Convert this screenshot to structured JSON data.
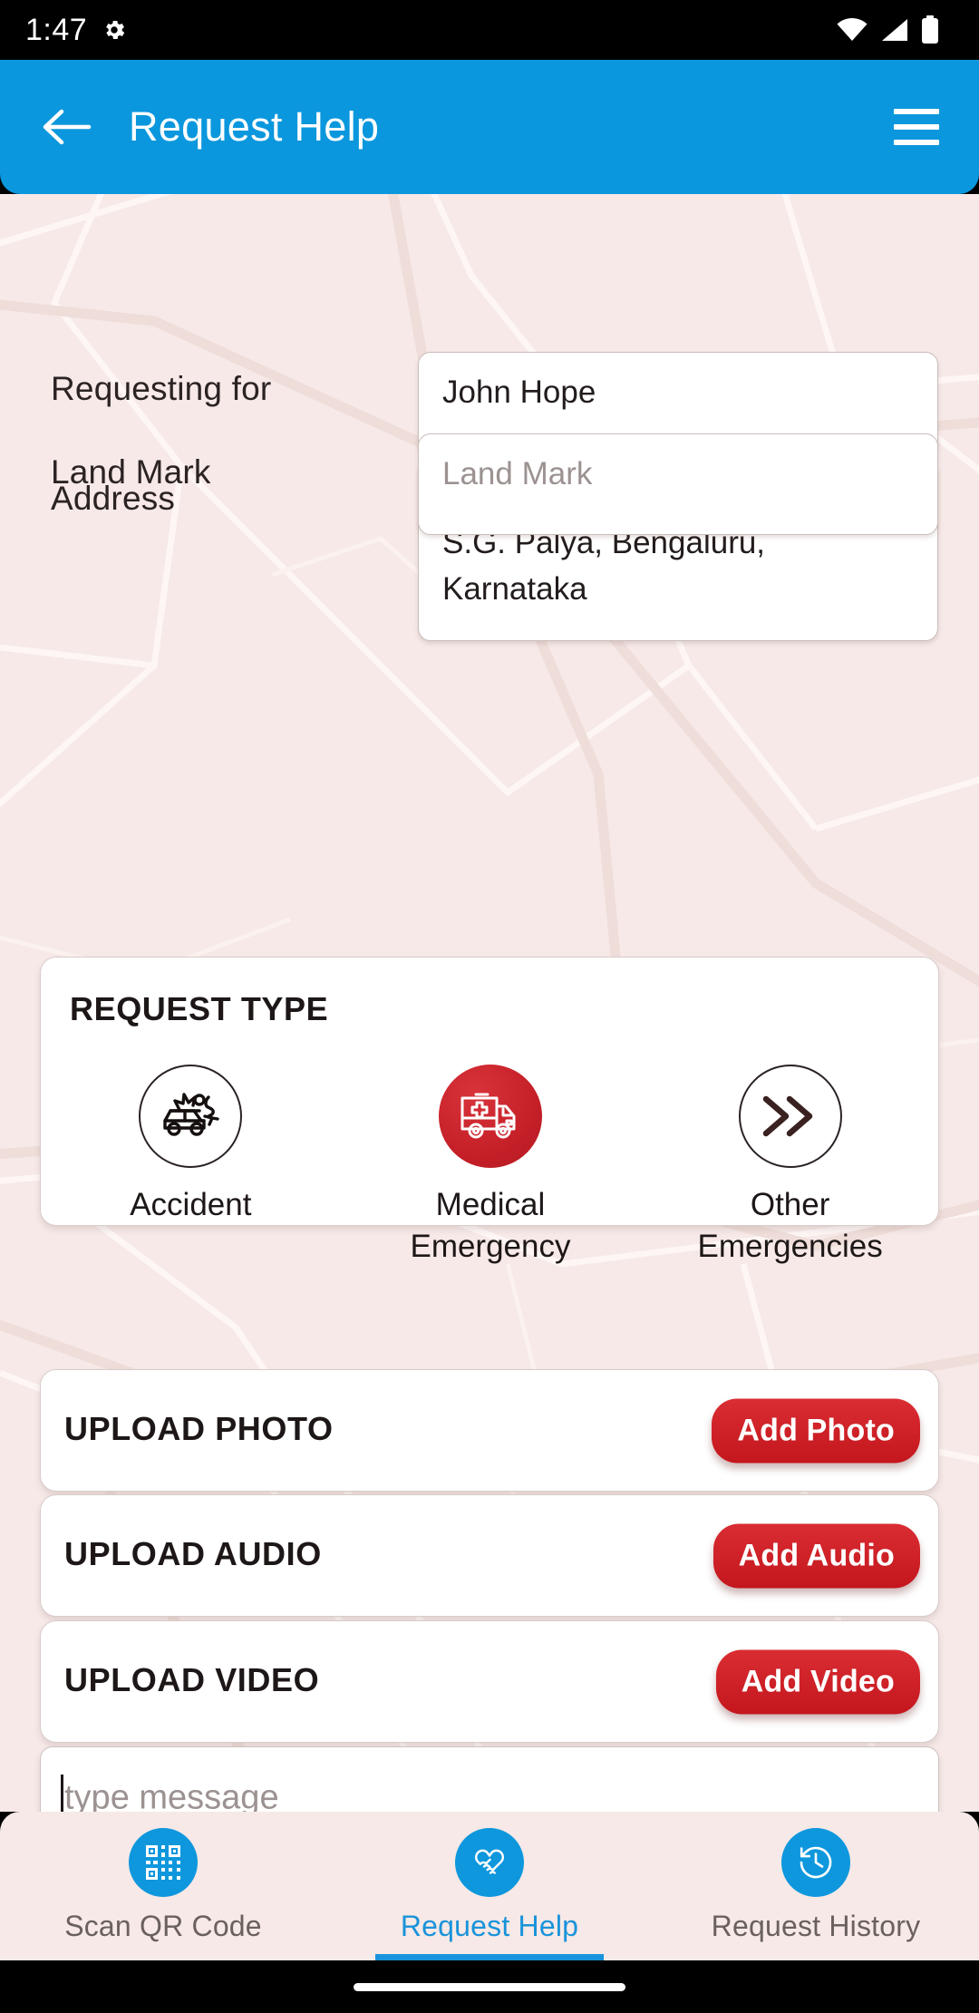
{
  "status_bar": {
    "clock": "1:47",
    "icons": [
      "gear-icon",
      "wifi-icon",
      "cellular-signal-icon",
      "battery-icon"
    ]
  },
  "app_bar": {
    "title": "Request Help",
    "back_icon": "back-arrow-icon",
    "menu_icon": "hamburger-menu-icon",
    "background_color": "#0b97dd"
  },
  "form": {
    "requesting_for": {
      "label": "Requesting for",
      "value": "John Hope",
      "placeholder": "Requesting for"
    },
    "address": {
      "label": "Address",
      "value": "Tank Bund Rd, Bhavani Nagar, S.G. Palya, Bengaluru, Karnataka",
      "placeholder": "Address"
    },
    "land_mark": {
      "label": "Land Mark",
      "value": "",
      "placeholder": "Land Mark"
    }
  },
  "request_type": {
    "title": "REQUEST TYPE",
    "selected": "Medical Emergency",
    "selected_color": "#c51f28",
    "options": [
      {
        "label": "Accident",
        "icon": "car-crash-accident-icon",
        "selected": false
      },
      {
        "label": "Medical Emergency",
        "icon": "ambulance-icon",
        "selected": true
      },
      {
        "label": "Other Emergencies",
        "icon": "double-chevron-right-icon",
        "selected": false
      }
    ]
  },
  "uploads": [
    {
      "title": "UPLOAD PHOTO",
      "button": "Add Photo"
    },
    {
      "title": "UPLOAD AUDIO",
      "button": "Add Audio"
    },
    {
      "title": "UPLOAD VIDEO",
      "button": "Add Video"
    }
  ],
  "message": {
    "placeholder": "type message",
    "value": ""
  },
  "bottom_nav": {
    "active": "Request Help",
    "accent_color": "#1a93da",
    "items": [
      {
        "label": "Scan QR Code",
        "icon": "qr-code-icon",
        "active": false
      },
      {
        "label": "Request Help",
        "icon": "handshake-heart-icon",
        "active": true
      },
      {
        "label": "Request History",
        "icon": "history-clock-icon",
        "active": false
      }
    ]
  },
  "theme": {
    "map_background": "#f6e9e7",
    "brand_blue": "#0b97dd",
    "brand_red": "#c51f28"
  }
}
